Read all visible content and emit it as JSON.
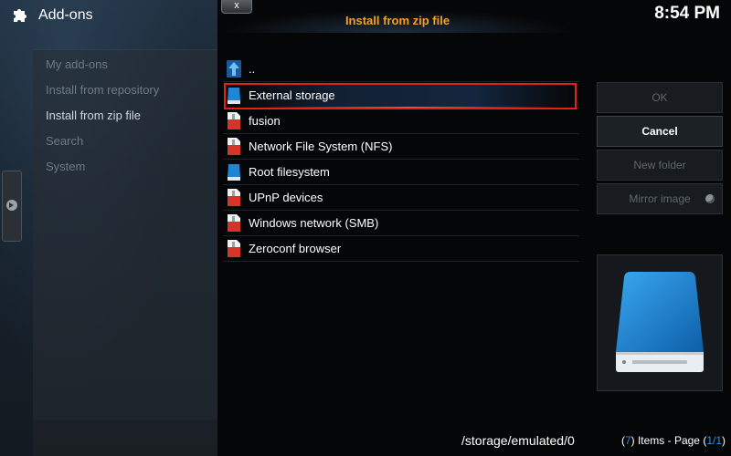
{
  "background": {
    "title": "Add-ons",
    "menu": [
      {
        "label": "My add-ons"
      },
      {
        "label": "Install from repository"
      },
      {
        "label": "Install from zip file"
      },
      {
        "label": "Search"
      },
      {
        "label": "System"
      }
    ]
  },
  "dialog": {
    "close_label": "x",
    "title": "Install from zip file",
    "clock": "8:54 PM",
    "files": [
      {
        "label": "..",
        "icon": "up-arrow-icon"
      },
      {
        "label": "External storage",
        "icon": "blue-drive-icon"
      },
      {
        "label": "fusion",
        "icon": "zip-file-icon"
      },
      {
        "label": "Network File System (NFS)",
        "icon": "zip-file-icon"
      },
      {
        "label": "Root filesystem",
        "icon": "blue-drive-icon"
      },
      {
        "label": "UPnP devices",
        "icon": "zip-file-icon"
      },
      {
        "label": "Windows network (SMB)",
        "icon": "zip-file-icon"
      },
      {
        "label": "Zeroconf browser",
        "icon": "zip-file-icon"
      }
    ],
    "path": "/storage/emulated/0",
    "items_open": "(",
    "items_count": "7",
    "items_mid": ") Items - Page (",
    "items_page": "1/1",
    "items_close": ")",
    "buttons": {
      "ok": "OK",
      "cancel": "Cancel",
      "new_folder": "New folder",
      "mirror_image": "Mirror image"
    }
  },
  "colors": {
    "accent_orange": "#f6a024",
    "highlight_red": "#e0221a",
    "link_blue": "#2a8fe6"
  }
}
